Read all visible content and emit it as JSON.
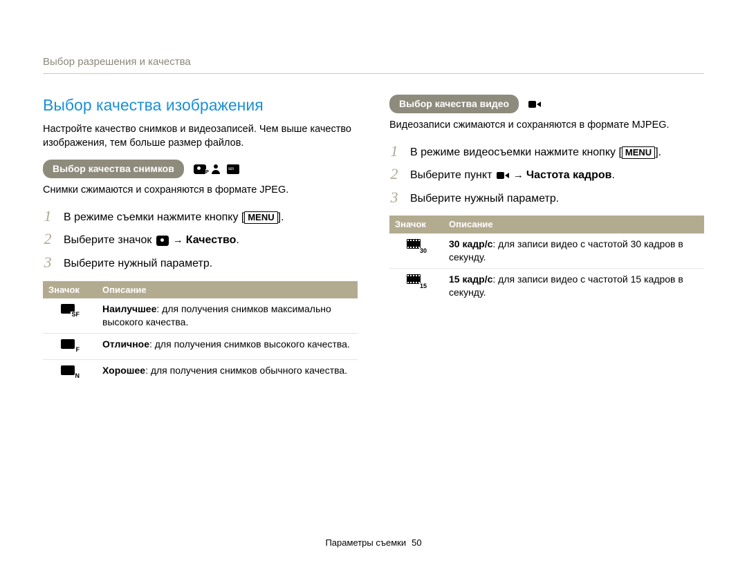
{
  "header_path": "Выбор разрешения и качества",
  "section_title": "Выбор качества изображения",
  "section_lead": "Настройте качество снимков и видеозаписей. Чем выше качество изображения, тем больше размер файлов.",
  "left": {
    "pill": "Выбор качества снимков",
    "format_note": "Снимки сжимаются и сохраняются в формате JPEG.",
    "steps": {
      "s1_a": "В режиме съемки нажмите кнопку ",
      "s1_btn": "MENU",
      "s1_b": ".",
      "s2_a": "Выберите значок ",
      "s2_target": "Качество",
      "s2_b": ".",
      "s3": "Выберите нужный параметр."
    },
    "table": {
      "h_icon": "Значок",
      "h_desc": "Описание",
      "rows": [
        {
          "sub": "SF",
          "bold": "Наилучшее",
          "rest": ": для получения снимков максимально высокого качества."
        },
        {
          "sub": "F",
          "bold": "Отличное",
          "rest": ": для получения снимков высокого качества."
        },
        {
          "sub": "N",
          "bold": "Хорошее",
          "rest": ": для получения снимков обычного качества."
        }
      ]
    }
  },
  "right": {
    "pill": "Выбор качества видео",
    "format_note": "Видеозаписи сжимаются и сохраняются в формате MJPEG.",
    "steps": {
      "s1_a": "В режиме видеосъемки нажмите кнопку ",
      "s1_btn": "MENU",
      "s1_b": ".",
      "s2_a": "Выберите пункт ",
      "s2_target": "Частота кадров",
      "s2_b": ".",
      "s3": "Выберите нужный параметр."
    },
    "table": {
      "h_icon": "Значок",
      "h_desc": "Описание",
      "rows": [
        {
          "sub": "30",
          "bold": "30 кадр/с",
          "rest": ": для записи видео с частотой 30 кадров в секунду."
        },
        {
          "sub": "15",
          "bold": "15 кадр/с",
          "rest": ": для записи видео с частотой 15 кадров в секунду."
        }
      ]
    }
  },
  "footer": {
    "label": "Параметры съемки",
    "page": "50"
  }
}
